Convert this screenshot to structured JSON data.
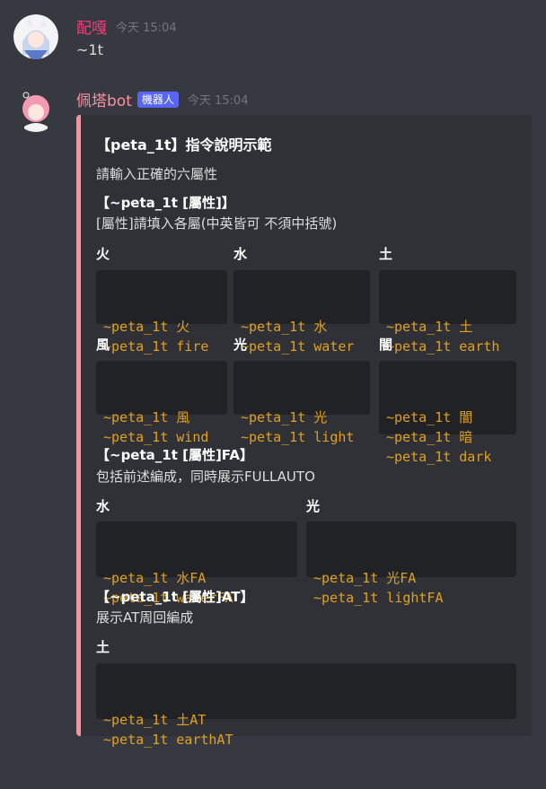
{
  "message1": {
    "username": "配嘎",
    "username_color": "#f23f7a",
    "timestamp": "今天 15:04",
    "content": "~1t"
  },
  "message2": {
    "username": "佩塔bot",
    "username_color": "#ff8fa0",
    "bot_tag": "機器人",
    "timestamp": "今天 15:04"
  },
  "embed": {
    "accent_color": "#ff8fa0",
    "title": "【peta_1t】指令說明示範",
    "description": "請輸入正確的六屬性",
    "sections": [
      {
        "heading": "【~peta_1t [屬性]】",
        "text": "[屬性]請填入各屬(中英皆可 不須中括號)"
      },
      {
        "heading": "【~peta_1t [屬性]FA】",
        "text": "包括前述編成，同時展示FULLAUTO"
      },
      {
        "heading": "【~peta_1t [屬性]AT】",
        "text": "展示AT周回編成"
      }
    ],
    "fields": [
      {
        "name": "火",
        "lines": [
          "~peta_1t 火",
          "~peta_1t fire"
        ]
      },
      {
        "name": "水",
        "lines": [
          "~peta_1t 水",
          "~peta_1t water"
        ]
      },
      {
        "name": "土",
        "lines": [
          "~peta_1t 土",
          "~peta_1t earth"
        ]
      },
      {
        "name": "風",
        "lines": [
          "~peta_1t 風",
          "~peta_1t wind"
        ]
      },
      {
        "name": "光",
        "lines": [
          "~peta_1t 光",
          "~peta_1t light"
        ]
      },
      {
        "name": "闇",
        "lines": [
          "~peta_1t 闇",
          "~peta_1t 暗",
          "~peta_1t dark"
        ]
      },
      {
        "name": "水",
        "lines": [
          "~peta_1t 水FA",
          "~peta_1t waterFA"
        ]
      },
      {
        "name": "光",
        "lines": [
          "~peta_1t 光FA",
          "~peta_1t lightFA"
        ]
      },
      {
        "name": "土",
        "lines": [
          "~peta_1t 土AT",
          "~peta_1t earthAT"
        ]
      }
    ]
  }
}
